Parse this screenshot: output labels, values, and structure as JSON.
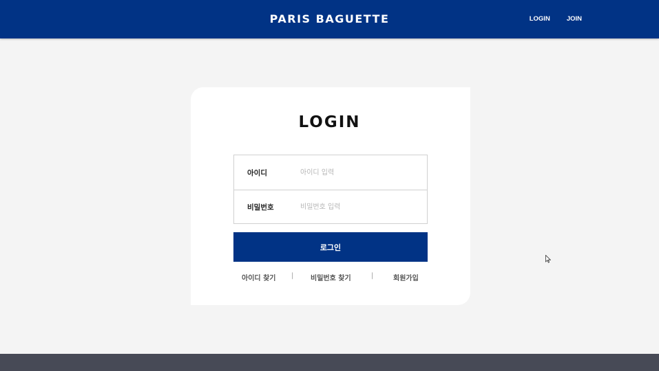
{
  "header": {
    "logo": "PARIS BAGUETTE",
    "nav": {
      "login": "LOGIN",
      "join": "JOIN"
    }
  },
  "login_card": {
    "title": "LOGIN",
    "id_field": {
      "label": "아이디",
      "placeholder": "아이디 입력",
      "value": ""
    },
    "password_field": {
      "label": "비밀번호",
      "placeholder": "비밀번호 입력",
      "value": ""
    },
    "submit_label": "로그인",
    "links": {
      "find_id": "아이디 찾기",
      "separator": "|",
      "find_password": "비밀번호 찾기",
      "signup": "회원가입"
    }
  },
  "colors": {
    "brand": "#013385",
    "page_background": "#f4f4f4",
    "footer": "#474a56"
  }
}
